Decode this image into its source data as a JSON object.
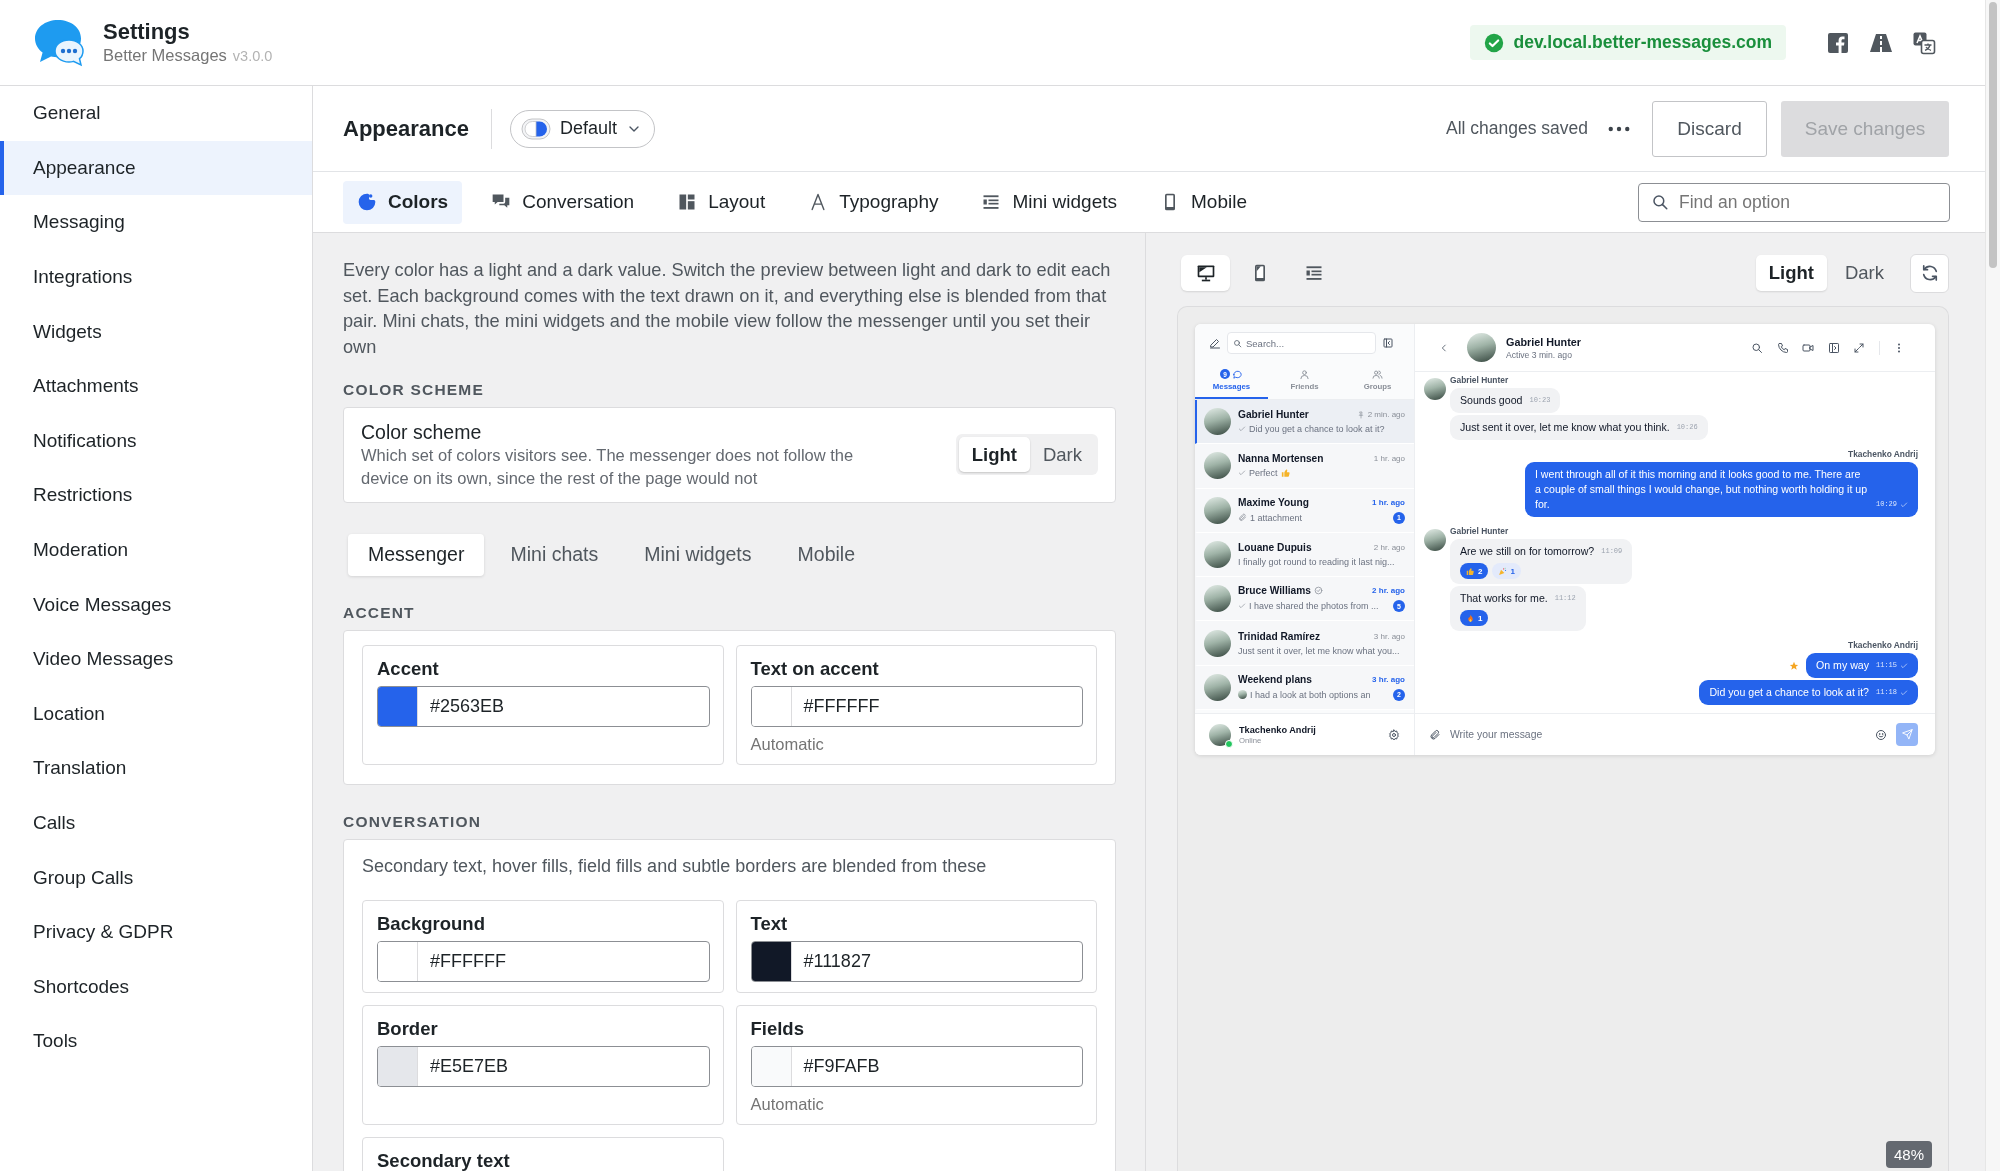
{
  "header": {
    "title": "Settings",
    "subtitle": "Better Messages",
    "version": "v3.0.0",
    "domain": "dev.local.better-messages.com"
  },
  "sidebar": {
    "items": [
      {
        "label": "General",
        "selected": false
      },
      {
        "label": "Appearance",
        "selected": true
      },
      {
        "label": "Messaging",
        "selected": false
      },
      {
        "label": "Integrations",
        "selected": false
      },
      {
        "label": "Widgets",
        "selected": false
      },
      {
        "label": "Attachments",
        "selected": false
      },
      {
        "label": "Notifications",
        "selected": false
      },
      {
        "label": "Restrictions",
        "selected": false
      },
      {
        "label": "Moderation",
        "selected": false
      },
      {
        "label": "Voice Messages",
        "selected": false
      },
      {
        "label": "Video Messages",
        "selected": false
      },
      {
        "label": "Location",
        "selected": false
      },
      {
        "label": "Translation",
        "selected": false
      },
      {
        "label": "Calls",
        "selected": false
      },
      {
        "label": "Group Calls",
        "selected": false
      },
      {
        "label": "Privacy & GDPR",
        "selected": false
      },
      {
        "label": "Shortcodes",
        "selected": false
      },
      {
        "label": "Tools",
        "selected": false
      }
    ]
  },
  "toolbar": {
    "title": "Appearance",
    "preset": "Default",
    "status": "All changes saved",
    "discard": "Discard",
    "save": {
      "label": "Save changes",
      "disabled": true
    }
  },
  "tabs": [
    {
      "label": "Colors",
      "kind": "colors",
      "selected": true
    },
    {
      "label": "Conversation",
      "kind": "conversation",
      "selected": false
    },
    {
      "label": "Layout",
      "kind": "layout",
      "selected": false
    },
    {
      "label": "Typography",
      "kind": "typography",
      "selected": false
    },
    {
      "label": "Mini widgets",
      "kind": "widgets",
      "selected": false
    },
    {
      "label": "Mobile",
      "kind": "mobile",
      "selected": false
    }
  ],
  "search": {
    "placeholder": "Find an option"
  },
  "intro": "Every color has a light and a dark value. Switch the preview between light and dark to edit each set. Each background comes with the text drawn on it, and everything else is blended from that pair. Mini chats, the mini widgets and the mobile view follow the messenger until you set their own",
  "color_scheme": {
    "heading": "COLOR SCHEME",
    "title": "Color scheme",
    "description": "Which set of colors visitors see. The messenger does not follow the device on its own, since the rest of the page would not",
    "options": [
      {
        "label": "Light",
        "selected": true
      },
      {
        "label": "Dark",
        "selected": false
      }
    ]
  },
  "scope_tabs": [
    {
      "label": "Messenger",
      "selected": true
    },
    {
      "label": "Mini chats",
      "selected": false
    },
    {
      "label": "Mini widgets",
      "selected": false
    },
    {
      "label": "Mobile",
      "selected": false
    }
  ],
  "sections": [
    {
      "heading": "ACCENT",
      "fields": [
        {
          "label": "Accent",
          "value": "#2563EB",
          "color": "#2563eb"
        },
        {
          "label": "Text on accent",
          "value": "#FFFFFF",
          "color": "#ffffff",
          "note": "Automatic"
        }
      ]
    },
    {
      "heading": "CONVERSATION",
      "description": "Secondary text, hover fills, field fills and subtle borders are blended from these",
      "fields": [
        {
          "label": "Background",
          "value": "#FFFFFF",
          "color": "#ffffff"
        },
        {
          "label": "Text",
          "value": "#111827",
          "color": "#111827"
        },
        {
          "label": "Border",
          "value": "#E5E7EB",
          "color": "#e5e7eb"
        },
        {
          "label": "Fields",
          "value": "#F9FAFB",
          "color": "#f9fafb",
          "note": "Automatic"
        },
        {
          "label": "Secondary text"
        }
      ]
    }
  ],
  "preview": {
    "devices": [
      {
        "kind": "desktop",
        "selected": true
      },
      {
        "kind": "mobile",
        "selected": false
      },
      {
        "kind": "widgets",
        "selected": false
      }
    ],
    "modes": [
      {
        "label": "Light",
        "selected": true
      },
      {
        "label": "Dark",
        "selected": false
      }
    ],
    "zoom": "48%",
    "messenger": {
      "search": {
        "placeholder": "Search..."
      },
      "tabs": [
        {
          "label": "Messages",
          "kind": "messages",
          "badge": "9",
          "selected": true
        },
        {
          "label": "Friends",
          "kind": "friends",
          "selected": false
        },
        {
          "label": "Groups",
          "kind": "groups",
          "selected": false
        }
      ],
      "threads": [
        {
          "kind": "text",
          "name": "Gabriel Hunter",
          "verified": false,
          "pinned": true,
          "time": "2 min. ago",
          "unread": false,
          "read": true,
          "preview": "Did you get a chance to look at it?",
          "selected": true
        },
        {
          "kind": "thumbs",
          "name": "Nanna Mortensen",
          "verified": false,
          "pinned": false,
          "time": "1 hr. ago",
          "unread": false,
          "read": true,
          "preview": "Perfect",
          "selected": false
        },
        {
          "kind": "attachment",
          "name": "Maxime Young",
          "verified": false,
          "pinned": false,
          "time": "1 hr. ago",
          "unread": true,
          "read": false,
          "preview": "1 attachment",
          "count": "1",
          "selected": false
        },
        {
          "kind": "text",
          "name": "Louane Dupuis",
          "verified": false,
          "pinned": false,
          "time": "2 hr. ago",
          "unread": false,
          "read": false,
          "preview": "I finally got round to reading it last nig...",
          "selected": false
        },
        {
          "kind": "text",
          "name": "Bruce Williams",
          "verified": true,
          "pinned": false,
          "time": "2 hr. ago",
          "unread": true,
          "read": true,
          "preview": "I have shared the photos from ...",
          "count": "5",
          "selected": false
        },
        {
          "kind": "text",
          "name": "Trinidad Ramírez",
          "verified": false,
          "pinned": false,
          "time": "3 hr. ago",
          "unread": false,
          "read": false,
          "preview": "Just sent it over, let me know what you...",
          "selected": false
        },
        {
          "kind": "group",
          "name": "Weekend plans",
          "verified": false,
          "pinned": false,
          "time": "3 hr. ago",
          "unread": true,
          "read": false,
          "preview": "I had a look at both options an",
          "count": "2",
          "selected": false
        }
      ],
      "footer": {
        "name": "Tkachenko Andrij",
        "status": "Online",
        "online": true
      },
      "chat": {
        "name": "Gabriel Hunter",
        "status": "Active 3 min. ago",
        "groups": [
          {
            "kind": "incoming",
            "sender": "Gabriel Hunter",
            "messages": [
              {
                "text": "Sounds good",
                "time": "10:23",
                "read": false,
                "starred": false
              },
              {
                "text": "Just sent it over, let me know what you think.",
                "time": "10:26",
                "read": false,
                "starred": false
              }
            ]
          },
          {
            "kind": "outgoing",
            "sender": "Tkachenko Andrij",
            "messages": [
              {
                "text": "I went through all of it this morning and it looks good to me. There are a couple of small things I would change, but nothing worth holding it up for.",
                "time": "10:29",
                "read": true,
                "starred": false
              }
            ]
          },
          {
            "kind": "incoming",
            "sender": "Gabriel Hunter",
            "messages": [
              {
                "text": "Are we still on for tomorrow?",
                "time": "11:09",
                "read": false,
                "starred": false,
                "reactions": [
                  {
                    "kind": "thumbs",
                    "count": "2",
                    "mine": true
                  },
                  {
                    "kind": "party",
                    "count": "1",
                    "mine": false
                  }
                ]
              },
              {
                "text": "That works for me.",
                "time": "11:12",
                "read": false,
                "starred": false,
                "reactions": [
                  {
                    "kind": "fire",
                    "count": "1",
                    "mine": true
                  }
                ]
              }
            ]
          },
          {
            "kind": "outgoing",
            "sender": "Tkachenko Andrij",
            "messages": [
              {
                "text": "On my way",
                "time": "11:15",
                "read": true,
                "starred": true
              },
              {
                "text": "Did you get a chance to look at it?",
                "time": "11:18",
                "read": true,
                "starred": false
              }
            ]
          }
        ],
        "composer": {
          "placeholder": "Write your message"
        }
      }
    }
  }
}
